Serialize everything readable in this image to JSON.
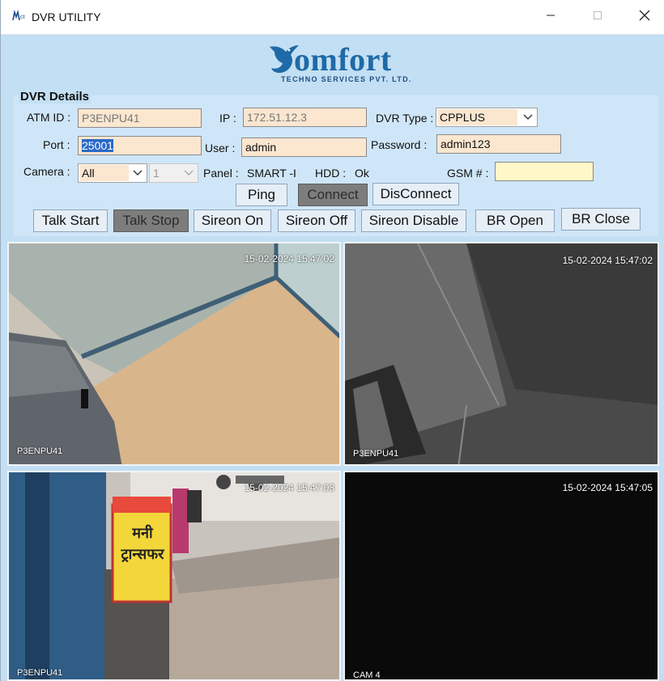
{
  "window": {
    "title": "DVR UTILITY"
  },
  "logo": {
    "word": "omfort",
    "subtitle": "TECHNO SERVICES PVT. LTD."
  },
  "details": {
    "group_label": "DVR Details",
    "atm_id_label": "ATM ID :",
    "atm_id": "P3ENPU41",
    "ip_label": "IP :",
    "ip": "172.51.12.3",
    "dvr_type_label": "DVR Type :",
    "dvr_type": "CPPLUS",
    "port_label": "Port :",
    "port": "25001",
    "user_label": "User :",
    "user": "admin",
    "password_label": "Password :",
    "password": "admin123",
    "camera_label": "Camera :",
    "camera": "All",
    "channel": "1",
    "panel_label": "Panel :",
    "panel": "SMART -I",
    "hdd_label": "HDD :",
    "hdd": "Ok",
    "gsm_label": "GSM # :",
    "gsm": ""
  },
  "buttons": {
    "ping": "Ping",
    "connect": "Connect",
    "disconnect": "DisConnect",
    "talk_start": "Talk Start",
    "talk_stop": "Talk Stop",
    "sireon_on": "Sireon On",
    "sireon_off": "Sireon Off",
    "sireon_disable": "Sireon Disable",
    "br_open": "BR Open",
    "br_close": "BR Close"
  },
  "cameras": [
    {
      "timestamp": "15-02-2024 15:47:02",
      "label": "P3ENPU41"
    },
    {
      "timestamp": "15-02-2024 15:47:02",
      "label": "P3ENPU41"
    },
    {
      "timestamp": "15-02-2024 15:47:03",
      "label": "P3ENPU41",
      "sign_text": "मनी ट्रान्सफर"
    },
    {
      "timestamp": "15-02-2024 15:47:05",
      "label": "CAM 4"
    }
  ],
  "colors": {
    "accent": "#1f6aa6",
    "window_bg": "#c3dff3",
    "field_bg": "#fbe6d0",
    "gsm_bg": "#fff7c8",
    "pressed": "#7d7d7d"
  },
  "icons": [
    "app-icon",
    "minimize-icon",
    "maximize-icon",
    "close-icon",
    "chevron-down-icon",
    "logo-bird-icon"
  ]
}
